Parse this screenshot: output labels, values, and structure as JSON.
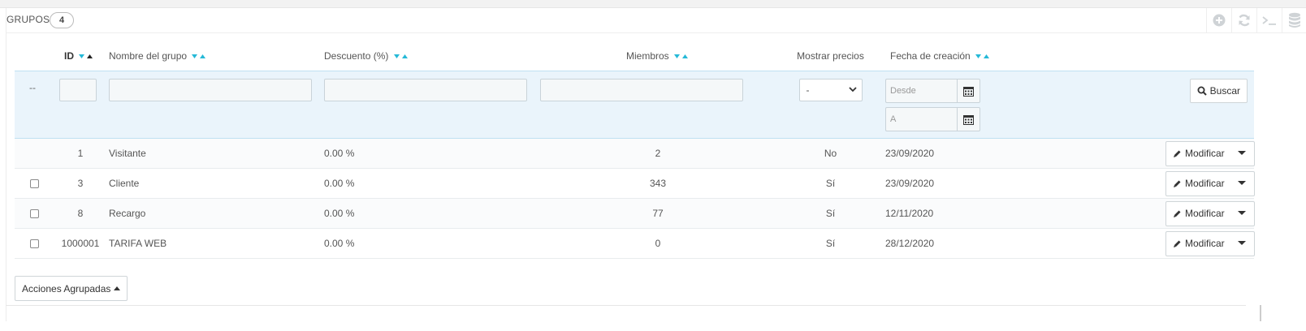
{
  "panel": {
    "title": "GRUPOS",
    "count": "4",
    "tools": [
      "add-icon",
      "refresh-icon",
      "terminal-icon",
      "database-icon"
    ]
  },
  "columns": {
    "id": "ID",
    "name": "Nombre del grupo",
    "discount": "Descuento (%)",
    "members": "Miembros",
    "show_prices": "Mostrar precios",
    "created": "Fecha de creación"
  },
  "filters": {
    "select_all_marker": "--",
    "show_prices_selected": "-",
    "date_from_placeholder": "Desde",
    "date_to_placeholder": "A",
    "search_label": "Buscar"
  },
  "rows": [
    {
      "id": "1",
      "name": "Visitante",
      "discount": "0.00 %",
      "members": "2",
      "show_prices": "No",
      "created": "23/09/2020",
      "has_checkbox": false
    },
    {
      "id": "3",
      "name": "Cliente",
      "discount": "0.00 %",
      "members": "343",
      "show_prices": "Sí",
      "created": "23/09/2020",
      "has_checkbox": true
    },
    {
      "id": "8",
      "name": "Recargo",
      "discount": "0.00 %",
      "members": "77",
      "show_prices": "Sí",
      "created": "12/11/2020",
      "has_checkbox": true
    },
    {
      "id": "1000001",
      "name": "TARIFA WEB",
      "discount": "0.00 %",
      "members": "0",
      "show_prices": "Sí",
      "created": "28/12/2020",
      "has_checkbox": true
    }
  ],
  "row_action_label": "Modificar",
  "bulk_actions_label": "Acciones Agrupadas",
  "colors": {
    "accent": "#25b9d7",
    "filter_bg": "#eaf4fb"
  }
}
